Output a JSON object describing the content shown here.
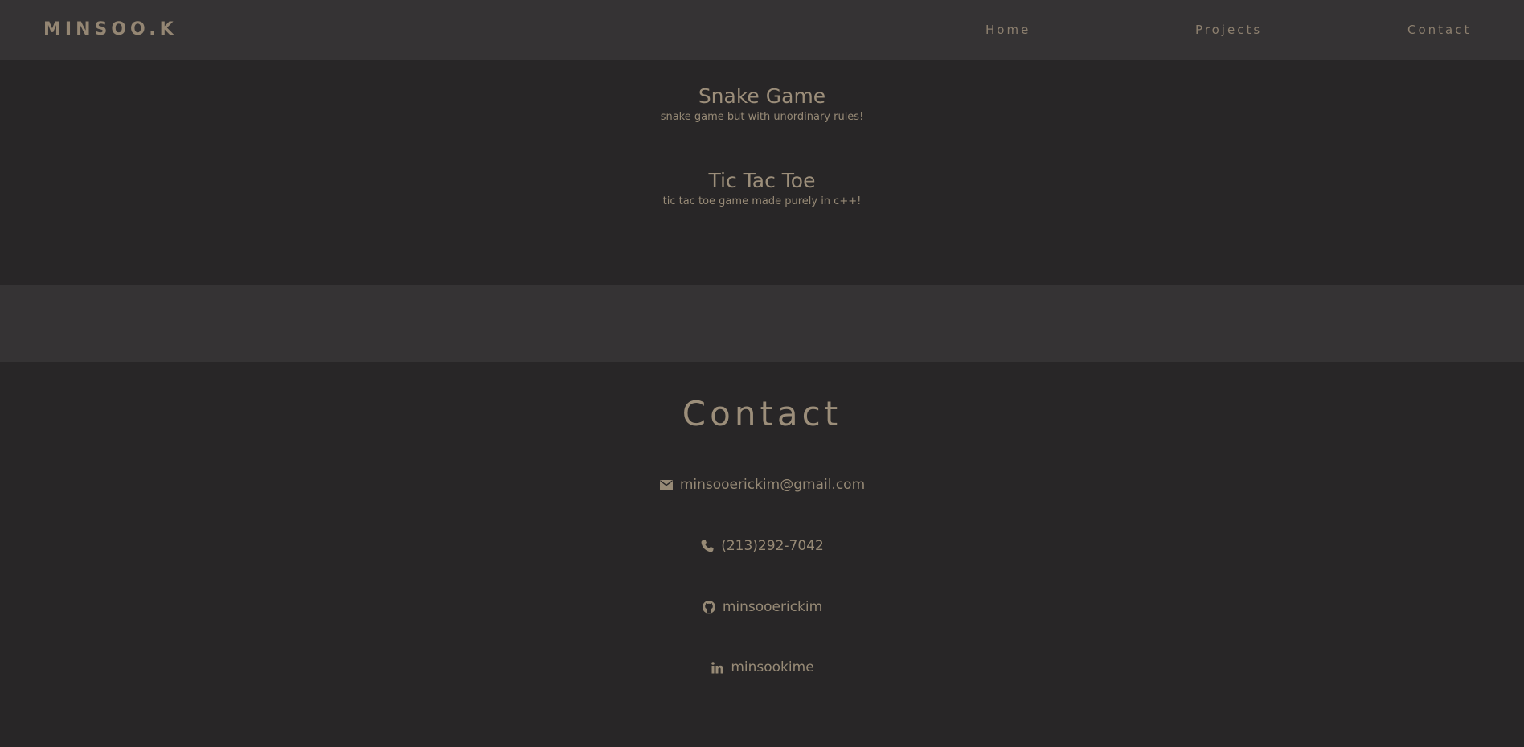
{
  "navbar": {
    "brand": "MINSOO.K",
    "links": [
      {
        "label": "Home"
      },
      {
        "label": "Projects"
      },
      {
        "label": "Contact"
      }
    ]
  },
  "projects": [
    {
      "title": "Snake Game",
      "description": "snake game but with unordinary rules!"
    },
    {
      "title": "Tic Tac Toe",
      "description": "tic tac toe game made purely in c++!"
    }
  ],
  "contact": {
    "heading": "Contact",
    "items": [
      {
        "icon": "envelope-icon",
        "text": "minsooerickim@gmail.com"
      },
      {
        "icon": "phone-icon",
        "text": "(213)292-7042"
      },
      {
        "icon": "github-icon",
        "text": "minsooerickim"
      },
      {
        "icon": "linkedin-icon",
        "text": "minsookime"
      }
    ]
  },
  "colors": {
    "background": "#282627",
    "navbar_background": "#353334",
    "text": "#9a8c78"
  }
}
